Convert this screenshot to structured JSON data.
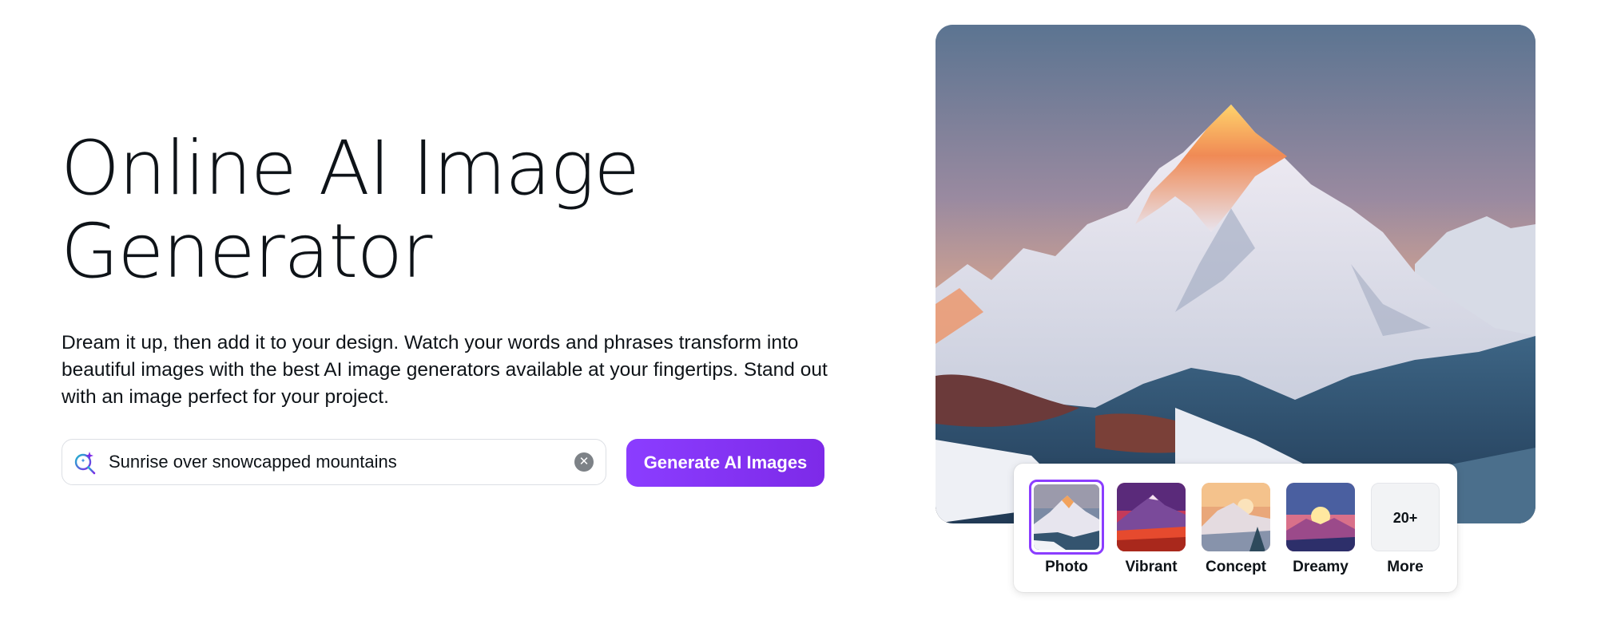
{
  "hero": {
    "title_line1": "Online AI Image",
    "title_line2": "Generator",
    "description": "Dream it up, then add it to your design. Watch your words and phrases transform into beautiful images with the best AI image generators available at your fingertips. Stand out with an image perfect for your project."
  },
  "prompt": {
    "value": "Sunrise over snowcapped mountains",
    "icon": "ai-search-sparkle-icon",
    "clear_icon": "clear-x-icon"
  },
  "generate_button": {
    "label": "Generate AI Images",
    "color": "#8b3dff"
  },
  "styles": [
    {
      "label": "Photo",
      "selected": true
    },
    {
      "label": "Vibrant",
      "selected": false
    },
    {
      "label": "Concept",
      "selected": false
    },
    {
      "label": "Dreamy",
      "selected": false
    }
  ],
  "more": {
    "count_label": "20+",
    "label": "More"
  },
  "colors": {
    "accent": "#8b3dff",
    "text": "#0e1318"
  }
}
